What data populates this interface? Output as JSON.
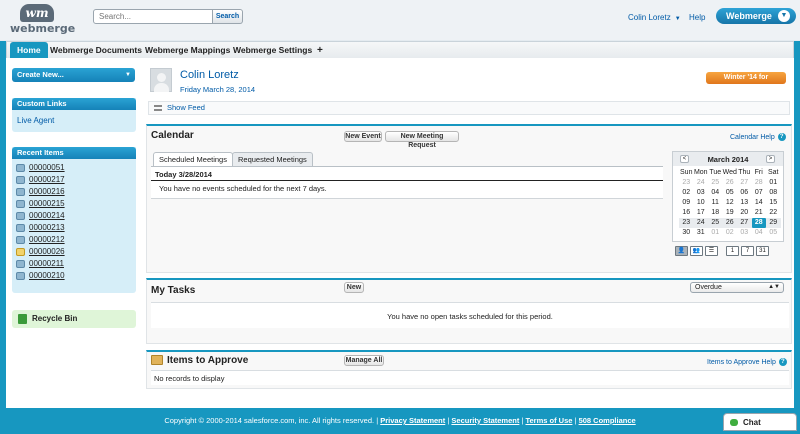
{
  "header": {
    "logo_mark": "wm",
    "logo_text": "webmerge",
    "search_placeholder": "Search...",
    "search_button": "Search",
    "user_name": "Colin Loretz",
    "help": "Help",
    "app_switcher": "Webmerge"
  },
  "tabs": [
    "Home",
    "Webmerge Documents",
    "Webmerge Mappings",
    "Webmerge Settings",
    "+"
  ],
  "sidebar": {
    "create_new": "Create New...",
    "custom_links_title": "Custom Links",
    "custom_links": [
      "Live Agent"
    ],
    "recent_items_title": "Recent Items",
    "recent_items": [
      {
        "label": "00000051",
        "icon": "record-icon"
      },
      {
        "label": "00000217",
        "icon": "record-icon"
      },
      {
        "label": "00000216",
        "icon": "record-icon"
      },
      {
        "label": "00000215",
        "icon": "record-icon"
      },
      {
        "label": "00000214",
        "icon": "record-icon"
      },
      {
        "label": "00000213",
        "icon": "record-icon"
      },
      {
        "label": "00000212",
        "icon": "record-icon"
      },
      {
        "label": "00000026",
        "icon": "document-icon"
      },
      {
        "label": "00000211",
        "icon": "record-icon"
      },
      {
        "label": "00000210",
        "icon": "record-icon"
      }
    ],
    "recycle_bin": "Recycle Bin"
  },
  "profile": {
    "name": "Colin Loretz",
    "date": "Friday March 28, 2014",
    "promo": "Winter '14 for Developers",
    "show_feed": "Show Feed"
  },
  "calendar": {
    "title": "Calendar",
    "new_event": "New Event",
    "new_meeting": "New Meeting Request",
    "help": "Calendar Help",
    "tabs": [
      "Scheduled Meetings",
      "Requested Meetings"
    ],
    "today_label": "Today 3/28/2014",
    "empty_msg": "You have no events scheduled for the next 7 days.",
    "month": "March 2014",
    "prev": "<",
    "next": ">",
    "weekdays": [
      "Sun",
      "Mon",
      "Tue",
      "Wed",
      "Thu",
      "Fri",
      "Sat"
    ],
    "weeks": [
      [
        "23",
        "24",
        "25",
        "26",
        "27",
        "28",
        "01"
      ],
      [
        "02",
        "03",
        "04",
        "05",
        "06",
        "07",
        "08"
      ],
      [
        "09",
        "10",
        "11",
        "12",
        "13",
        "14",
        "15"
      ],
      [
        "16",
        "17",
        "18",
        "19",
        "20",
        "21",
        "22"
      ],
      [
        "23",
        "24",
        "25",
        "26",
        "27",
        "28",
        "29"
      ],
      [
        "30",
        "31",
        "01",
        "02",
        "03",
        "04",
        "05"
      ]
    ],
    "view_day": "1",
    "view_week": "7",
    "view_month": "31"
  },
  "tasks": {
    "title": "My Tasks",
    "new": "New",
    "filter": "Overdue",
    "empty_msg": "You have no open tasks scheduled for this period."
  },
  "approvals": {
    "title": "Items to Approve",
    "manage_all": "Manage All",
    "help": "Items to Approve Help",
    "empty_msg": "No records to display"
  },
  "footer": {
    "copyright": "Copyright © 2000-2014 salesforce.com, inc. All rights reserved.",
    "links": [
      "Privacy Statement",
      "Security Statement",
      "Terms of Use",
      "508 Compliance"
    ]
  },
  "chat": "Chat",
  "colors": {
    "accent": "#1797c0",
    "promo": "#e98a2c"
  }
}
